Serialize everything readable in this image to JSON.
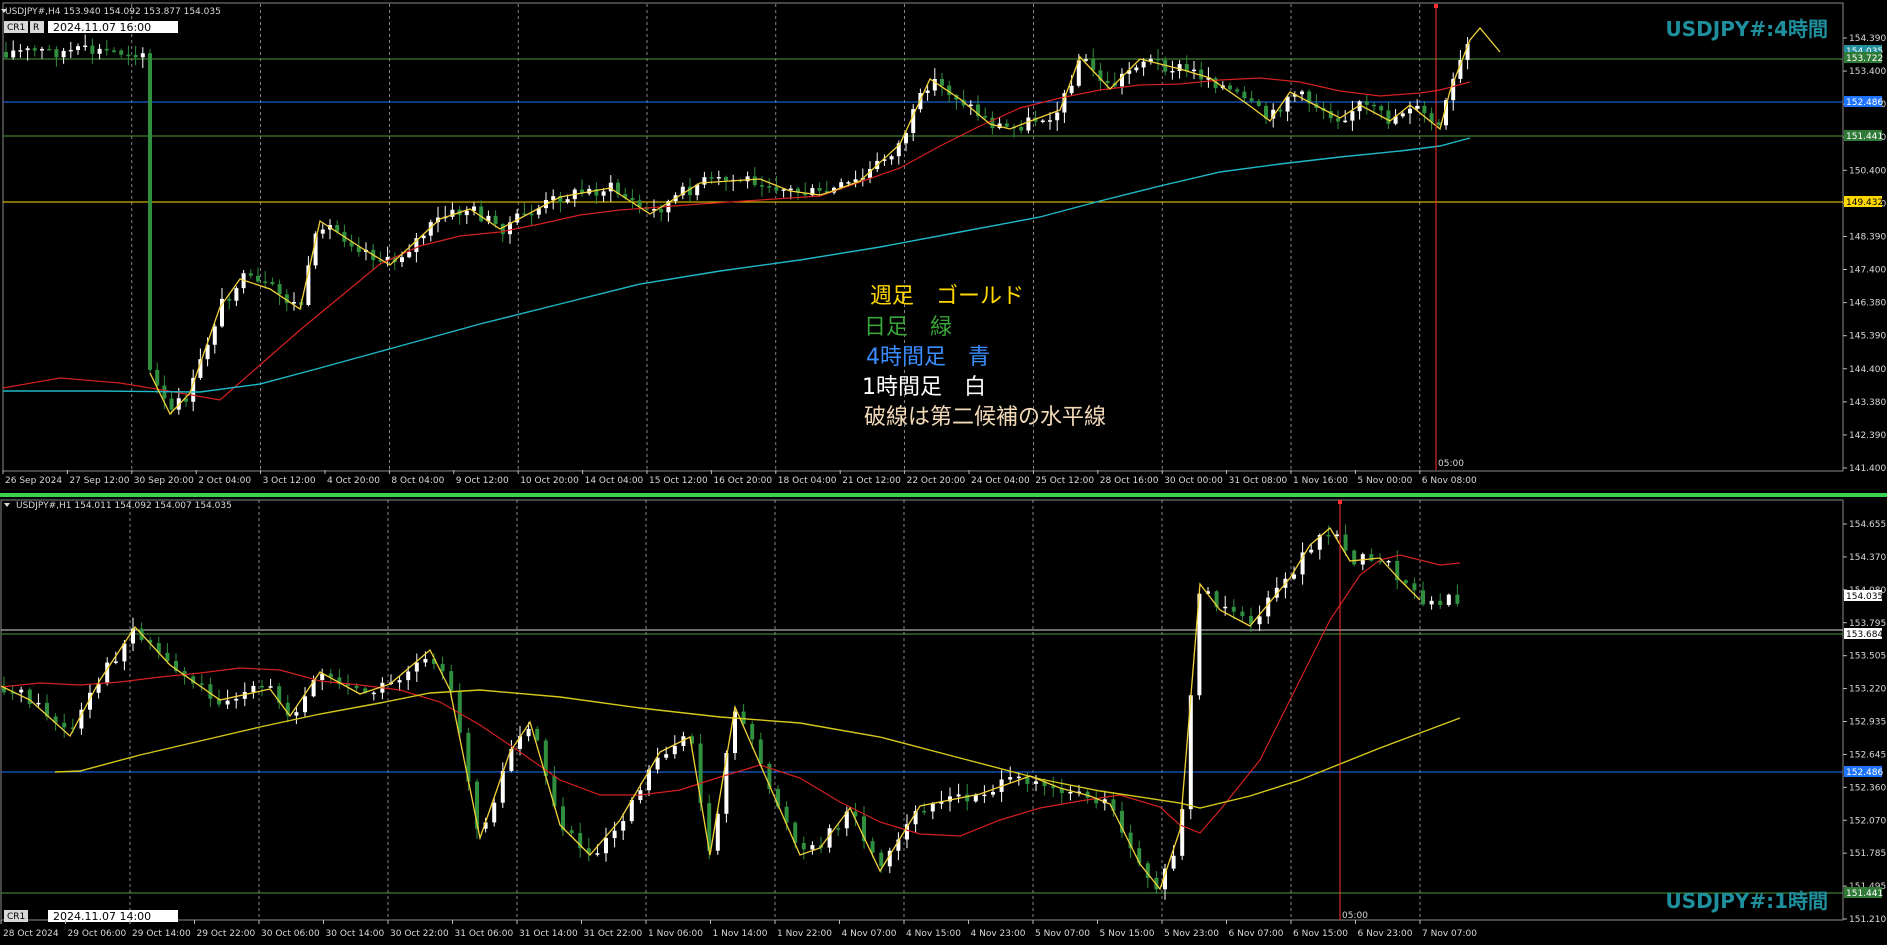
{
  "colors": {
    "bg": "#000000",
    "grid": "#ffffff",
    "gold": "#ffd800",
    "green_line": "#4a9a3c",
    "blue_line": "#1e74ff",
    "white_line": "#d8d8d8",
    "ma_red": "#d42020",
    "ma_cyan": "#1fb8c8",
    "ma_yellow": "#d6c81a",
    "zigzag": "#f2d23a",
    "candle_up": "#ffffff",
    "candle_down": "#2f8f3f",
    "vline": "#ff3030",
    "watermark": "#1f8f9d"
  },
  "top_panel": {
    "header_text": "USDJPY#,H4  153.940 154.092 153.877 154.035",
    "badge_cr": "CR1",
    "badge_r": "R",
    "date_box": "2024.11.07 16:00",
    "watermark": "USDJPY#:4時間",
    "time_label": "05:00",
    "price_ticks": [
      "154.390",
      "153.400",
      "152.400",
      "151.410",
      "150.400",
      "149.400",
      "148.390",
      "147.400",
      "146.380",
      "145.390",
      "144.400",
      "143.380",
      "142.390",
      "141.400"
    ],
    "price_boxes": [
      {
        "label": "154.035",
        "bg": "#1f8f9d"
      },
      {
        "label": "153.722",
        "bg": "#2f7a37"
      },
      {
        "label": "152.486",
        "bg": "#1e74ff"
      },
      {
        "label": "151.441",
        "bg": "#2f7a37"
      },
      {
        "label": "149.432",
        "bg": "#ffd800"
      }
    ],
    "time_ticks": [
      "26 Sep 2024",
      "27 Sep 12:00",
      "30 Sep 20:00",
      "2 Oct 04:00",
      "3 Oct 12:00",
      "4 Oct 20:00",
      "8 Oct 04:00",
      "9 Oct 12:00",
      "10 Oct 20:00",
      "14 Oct 04:00",
      "15 Oct 12:00",
      "16 Oct 20:00",
      "18 Oct 04:00",
      "21 Oct 12:00",
      "22 Oct 20:00",
      "24 Oct 04:00",
      "25 Oct 12:00",
      "28 Oct 16:00",
      "30 Oct 00:00",
      "31 Oct 08:00",
      "1 Nov 16:00",
      "5 Nov 00:00",
      "6 Nov 08:00"
    ],
    "notes": {
      "weekly": "週足　ゴールド",
      "daily": "日足　緑",
      "h4": "4時間足　青",
      "h1": "1時間足　白",
      "dashed": "破線は第二候補の水平線"
    }
  },
  "bottom_panel": {
    "header_text": "USDJPY#,H1  154.011 154.092 154.007 154.035",
    "badge_cr": "CR1",
    "date_box": "2024.11.07 14:00",
    "watermark": "USDJPY#:1時間",
    "time_label": "05:00",
    "price_ticks": [
      "154.655",
      "154.370",
      "154.080",
      "153.795",
      "153.505",
      "153.220",
      "152.935",
      "152.645",
      "152.360",
      "152.070",
      "151.785",
      "151.495",
      "151.210"
    ],
    "price_boxes": [
      {
        "label": "154.035",
        "bg": "#ffffff"
      },
      {
        "label": "153.684",
        "bg": "#ffffff"
      },
      {
        "label": "152.486",
        "bg": "#1e74ff"
      },
      {
        "label": "151.441",
        "bg": "#2f7a37"
      }
    ],
    "time_ticks": [
      "28 Oct 2024",
      "29 Oct 06:00",
      "29 Oct 14:00",
      "29 Oct 22:00",
      "30 Oct 06:00",
      "30 Oct 14:00",
      "30 Oct 22:00",
      "31 Oct 06:00",
      "31 Oct 14:00",
      "31 Oct 22:00",
      "1 Nov 06:00",
      "1 Nov 14:00",
      "1 Nov 22:00",
      "4 Nov 07:00",
      "4 Nov 15:00",
      "4 Nov 23:00",
      "5 Nov 07:00",
      "5 Nov 15:00",
      "5 Nov 23:00",
      "6 Nov 07:00",
      "6 Nov 15:00",
      "6 Nov 23:00",
      "7 Nov 07:00"
    ]
  }
}
